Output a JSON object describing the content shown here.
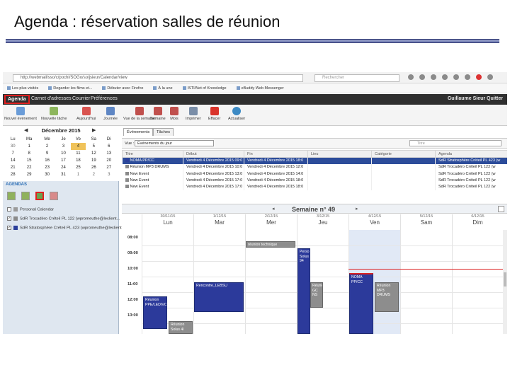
{
  "slide": {
    "title": "Agenda : réservation salles de réunion"
  },
  "browser": {
    "url": "http://webmail/sso/c/pochi/SOGo/so/jsieur/Calendar/view",
    "search_placeholder": "Rechercher",
    "bookmarks": [
      "Les plus visités",
      "Regarder les films et...",
      "Débuter avec Firefox",
      "À la une",
      "ISTI/Net of Knowledge",
      "eBuddy Web Messenger"
    ]
  },
  "menu": {
    "items": [
      "Agenda",
      "Carnet d'adresses",
      "Courrier",
      "Préférences"
    ],
    "user": "Guillaume Sieur   Quitter"
  },
  "toolbar": {
    "buttons": [
      "Nouvel événement",
      "Nouvelle tâche",
      "Aujourd'hui",
      "Journée",
      "Vue de la semaine",
      "Semaine",
      "Mois",
      "Imprimer",
      "Effacer",
      "Actualiser"
    ]
  },
  "minical": {
    "month": "Décembre 2015",
    "weekdays": [
      "Lu",
      "Ma",
      "Me",
      "Je",
      "Ve",
      "Sa",
      "Di"
    ],
    "weeks": [
      [
        "30",
        "1",
        "2",
        "3",
        "4",
        "5",
        "6"
      ],
      [
        "7",
        "8",
        "9",
        "10",
        "11",
        "12",
        "13"
      ],
      [
        "14",
        "15",
        "16",
        "17",
        "18",
        "19",
        "20"
      ],
      [
        "21",
        "22",
        "23",
        "24",
        "25",
        "26",
        "27"
      ],
      [
        "28",
        "29",
        "30",
        "31",
        "1",
        "2",
        "3"
      ]
    ],
    "selected": "4"
  },
  "agenda": {
    "heading": "AGENDAS",
    "calendars": [
      {
        "name": "Personal Calendar",
        "checked": false,
        "color": "#9a9a9a"
      },
      {
        "name": "SdR Trocadéro Créteil PL 122 (wpromeuthe@leclient...",
        "checked": true,
        "color": "#8a8a8a"
      },
      {
        "name": "SdR Stratosphère Créteil PL 423 (wpromeuthe@leclient...",
        "checked": true,
        "color": "#2b3f9b"
      }
    ]
  },
  "events_panel": {
    "tabs": [
      "Événements",
      "Tâches"
    ],
    "view_label": "Vue :",
    "view_value": "Événements du jour",
    "search_placeholder": "Titre",
    "columns": [
      "Titre",
      "Début",
      "Fin",
      "Lieu",
      "Catégorie",
      "Agenda"
    ],
    "rows": [
      {
        "title": "NOMA PP/CC",
        "start": "Vendredi 4 Décembre 2015 09:0",
        "end": "Vendredi 4 Décembre 2015 18:0",
        "location": "",
        "category": "",
        "calendar": "SdR Stratosphère Créteil PL 423 (w",
        "selected": true,
        "color": "blue"
      },
      {
        "title": "Réunion MP3 DRUMS",
        "start": "Vendredi 4 Décembre 2015 10:0",
        "end": "Vendredi 4 Décembre 2015 12:0",
        "location": "",
        "category": "",
        "calendar": "SdR Trocadéro Créteil PL 122 (w",
        "selected": false,
        "color": "grey"
      },
      {
        "title": "New Event",
        "start": "Vendredi 4 Décembre 2015 13:0",
        "end": "Vendredi 4 Décembre 2015 14:0",
        "location": "",
        "category": "",
        "calendar": "SdR Trocadéro Créteil PL 122 (w",
        "selected": false,
        "color": "grey"
      },
      {
        "title": "New Event",
        "start": "Vendredi 4 Décembre 2015 17:0",
        "end": "Vendredi 4 Décembre 2015 18:0",
        "location": "",
        "category": "",
        "calendar": "SdR Trocadéro Créteil PL 122 (w",
        "selected": false,
        "color": "grey"
      },
      {
        "title": "New Event",
        "start": "Vendredi 4 Décembre 2015 17:0",
        "end": "Vendredi 4 Décembre 2015 18:0",
        "location": "",
        "category": "",
        "calendar": "SdR Trocadéro Créteil PL 122 (w",
        "selected": false,
        "color": "grey"
      }
    ]
  },
  "week": {
    "title": "Semaine n° 49",
    "days": [
      {
        "date": "30/11/15",
        "name": "Lun"
      },
      {
        "date": "1/12/15",
        "name": "Mar"
      },
      {
        "date": "2/12/15",
        "name": "Mer"
      },
      {
        "date": "3/12/15",
        "name": "Jeu"
      },
      {
        "date": "4/12/15",
        "name": "Ven"
      },
      {
        "date": "5/12/15",
        "name": "Sam"
      },
      {
        "date": "6/12/15",
        "name": "Dim"
      }
    ],
    "hours": [
      "08:00",
      "09:00",
      "10:00",
      "11:00",
      "12:00",
      "13:00"
    ],
    "events": [
      {
        "label": "Réunion PPE/LEDIVCS",
        "color": "blue"
      },
      {
        "label": "Rencontre_LEBSU",
        "color": "blue"
      },
      {
        "label": "réunion technique",
        "color": "grey"
      },
      {
        "label": "Réunion Solus 4l",
        "color": "grey"
      },
      {
        "label": "Perso Solus 94",
        "color": "blue"
      },
      {
        "label": "Réunion GC NS",
        "color": "grey"
      },
      {
        "label": "NOMA PP/CC",
        "color": "blue"
      },
      {
        "label": "Réunion MP3 DRUMS",
        "color": "grey"
      }
    ]
  }
}
